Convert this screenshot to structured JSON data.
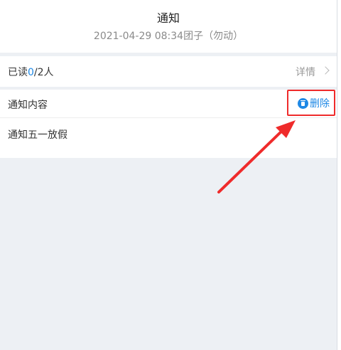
{
  "header": {
    "title": "通知",
    "meta": "2021-04-29 08:34团子（勿动）"
  },
  "read_status": {
    "label_prefix": "已读",
    "read_count": "0",
    "suffix": "/2人",
    "detail_label": "详情"
  },
  "content": {
    "label": "通知内容",
    "delete_label": "删除",
    "body": "通知五一放假"
  },
  "colors": {
    "accent": "#1e88e5",
    "highlight_red": "#ef2b2b"
  }
}
